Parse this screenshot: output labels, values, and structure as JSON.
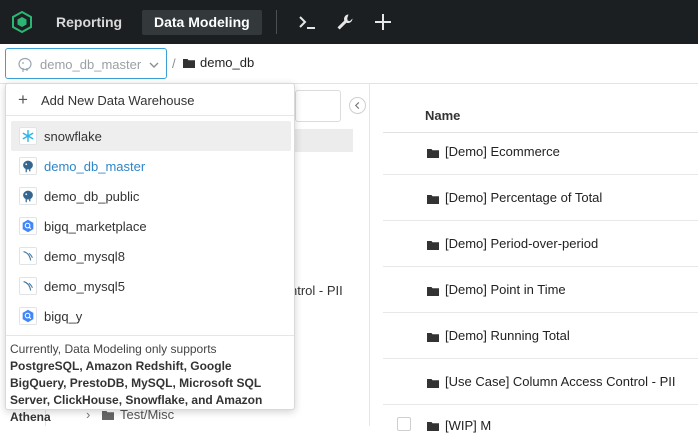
{
  "topbar": {
    "tabs": [
      {
        "label": "Reporting"
      },
      {
        "label": "Data Modeling",
        "active": true
      }
    ],
    "icons": [
      "terminal-icon",
      "wrench-icon",
      "plus-icon"
    ],
    "background": "#1b1f21",
    "accent": "#2bb673"
  },
  "breadcrumb": {
    "selected_datasource": "demo_db_master",
    "separator": "/",
    "current_folder": "demo_db"
  },
  "dropdown": {
    "add_label": "Add New Data Warehouse",
    "items": [
      {
        "label": "snowflake",
        "icon": "snowflake-icon"
      },
      {
        "label": "demo_db_master",
        "icon": "postgres-icon",
        "selected": true
      },
      {
        "label": "demo_db_public",
        "icon": "postgres-icon"
      },
      {
        "label": "bigq_marketplace",
        "icon": "bigquery-icon"
      },
      {
        "label": "demo_mysql8",
        "icon": "mysql-icon"
      },
      {
        "label": "demo_mysql5",
        "icon": "mysql-icon"
      },
      {
        "label": "bigq_y",
        "icon": "bigquery-icon"
      }
    ],
    "note_prefix": "Currently, Data Modeling only supports",
    "note_supported": "PostgreSQL, Amazon Redshift, Google BigQuery, PrestoDB, MySQL, Microsoft SQL Server, ClickHouse, Snowflake, and Amazon Athena"
  },
  "left_panel": {
    "peek_text": "ntrol - PII",
    "folder_label": "Test/Misc"
  },
  "table": {
    "header": "Name",
    "rows": [
      {
        "name": "[Demo] Ecommerce"
      },
      {
        "name": "[Demo] Percentage of Total"
      },
      {
        "name": "[Demo] Period-over-period"
      },
      {
        "name": "[Demo] Point in Time"
      },
      {
        "name": "[Demo] Running Total"
      },
      {
        "name": "[Use Case] Column Access Control - PII"
      },
      {
        "name": "[WIP] M"
      }
    ]
  },
  "colors": {
    "link_blue": "#2f86c8",
    "select_border": "#3aa0d6",
    "snowflake": "#29b5e8",
    "bigquery": "#4386fa"
  }
}
